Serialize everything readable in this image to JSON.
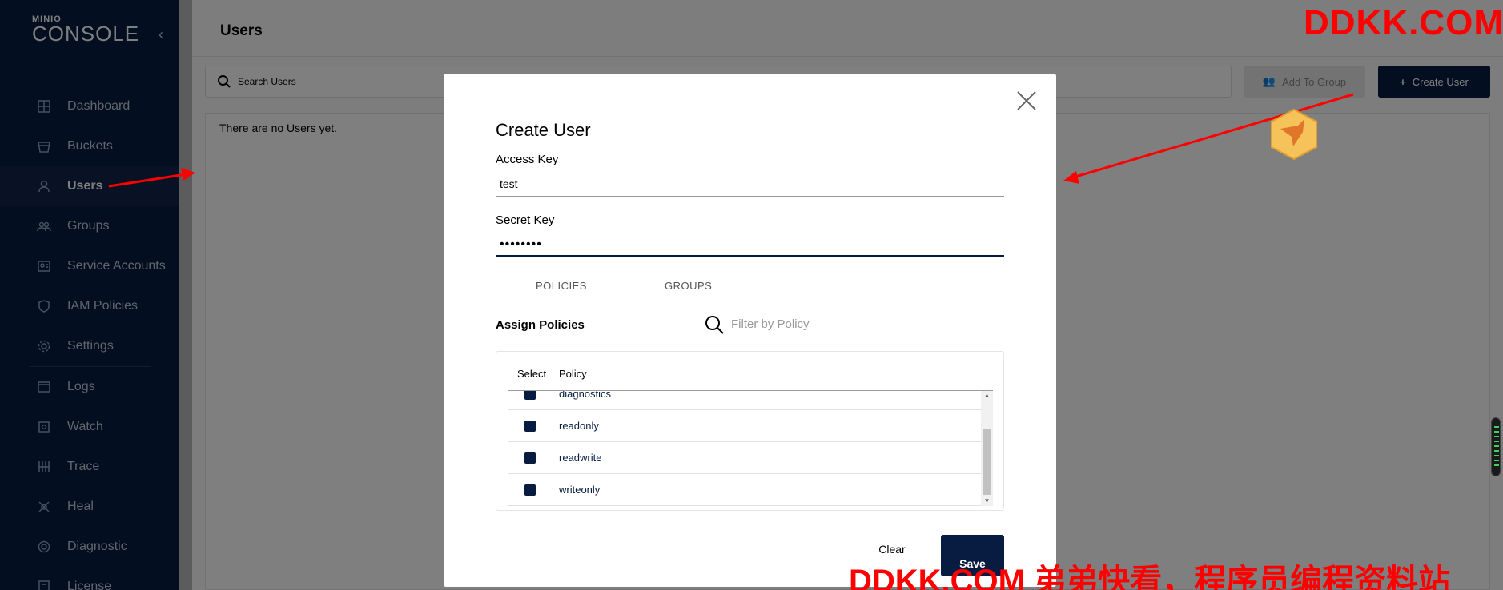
{
  "sidebar": {
    "logo_small": "MINIO",
    "logo_big": "CONSOLE",
    "collapse_icon": "chevron-left-icon",
    "items": [
      {
        "label": "Dashboard",
        "icon": "dashboard-icon"
      },
      {
        "label": "Buckets",
        "icon": "bucket-icon"
      },
      {
        "label": "Users",
        "icon": "user-icon",
        "active": true
      },
      {
        "label": "Groups",
        "icon": "groups-icon"
      },
      {
        "label": "Service Accounts",
        "icon": "service-account-icon"
      },
      {
        "label": "IAM Policies",
        "icon": "shield-icon"
      },
      {
        "label": "Settings",
        "icon": "gear-icon"
      },
      {
        "label": "Logs",
        "icon": "logs-icon"
      },
      {
        "label": "Watch",
        "icon": "watch-icon"
      },
      {
        "label": "Trace",
        "icon": "trace-icon"
      },
      {
        "label": "Heal",
        "icon": "heal-icon"
      },
      {
        "label": "Diagnostic",
        "icon": "diagnostic-icon"
      },
      {
        "label": "License",
        "icon": "license-icon"
      }
    ]
  },
  "main": {
    "title": "Users",
    "search_placeholder": "Search Users",
    "add_to_group_label": "Add To Group",
    "create_user_label": "Create User",
    "empty_text": "There are no Users yet."
  },
  "modal": {
    "title": "Create User",
    "access_key_label": "Access Key",
    "access_key_value": "test",
    "secret_key_label": "Secret Key",
    "secret_key_value": "••••••••",
    "tabs": [
      "POLICIES",
      "GROUPS"
    ],
    "assign_label": "Assign Policies",
    "filter_placeholder": "Filter by Policy",
    "table": {
      "columns": [
        "Select",
        "Policy"
      ],
      "rows": [
        "diagnostics",
        "readonly",
        "readwrite",
        "writeonly"
      ]
    },
    "clear_label": "Clear",
    "save_label": "Save"
  },
  "watermarks": {
    "top": "DDKK.COM",
    "bottom": "DDKK.COM 弟弟快看，程序员编程资料站"
  },
  "colors": {
    "sidebar_bg": "#081c42",
    "primary": "#081c42",
    "annotation_red": "#ff0000"
  }
}
